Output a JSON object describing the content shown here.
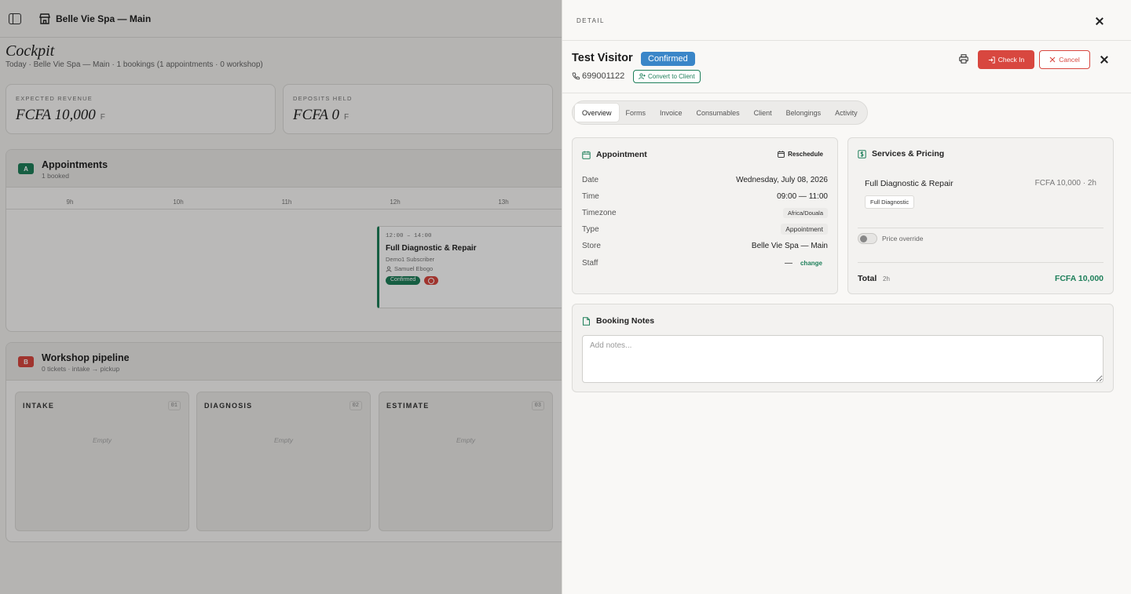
{
  "header": {
    "store_name": "Belle Vie Spa — Main"
  },
  "page": {
    "title": "Cockpit",
    "subtitle": "Today · Belle Vie Spa — Main · 1 bookings (1 appointments · 0 workshop)"
  },
  "kpis": [
    {
      "label": "EXPECTED REVENUE",
      "value": "FCFA 10,000",
      "unit": "F"
    },
    {
      "label": "DEPOSITS HELD",
      "value": "FCFA 0",
      "unit": "F"
    }
  ],
  "appointments": {
    "badge": "A",
    "title": "Appointments",
    "subtitle": "1 booked",
    "hours": [
      "9h",
      "10h",
      "11h",
      "12h",
      "13h"
    ],
    "card": {
      "time": "12:00 – 14:00",
      "service": "Full Diagnostic & Repair",
      "client": "Demo1 Subscriber",
      "staff": "Samuel Ebogo",
      "status": "Confirmed"
    }
  },
  "workshop": {
    "badge": "B",
    "title": "Workshop pipeline",
    "subtitle": "0 tickets · intake → pickup",
    "columns": [
      {
        "title": "INTAKE",
        "num": "01",
        "empty": "Empty"
      },
      {
        "title": "DIAGNOSIS",
        "num": "02",
        "empty": "Empty"
      },
      {
        "title": "ESTIMATE",
        "num": "03",
        "empty": "Empty"
      }
    ]
  },
  "drawer": {
    "label": "DETAIL",
    "visitor": "Test Visitor",
    "status": "Confirmed",
    "phone": "699001122",
    "convert_label": "Convert to Client",
    "checkin_label": "Check In",
    "cancel_label": "Cancel",
    "tabs": [
      "Overview",
      "Forms",
      "Invoice",
      "Consumables",
      "Client",
      "Belongings",
      "Activity"
    ],
    "appointment": {
      "title": "Appointment",
      "reschedule_label": "Reschedule",
      "date_k": "Date",
      "date_v": "Wednesday, July 08, 2026",
      "time_k": "Time",
      "time_v": "09:00 — 11:00",
      "tz_k": "Timezone",
      "tz_v": "Africa/Douala",
      "type_k": "Type",
      "type_v": "Appointment",
      "store_k": "Store",
      "store_v": "Belle Vie Spa — Main",
      "staff_k": "Staff",
      "staff_v": "—",
      "change_label": "change"
    },
    "services": {
      "title": "Services & Pricing",
      "name": "Full Diagnostic & Repair",
      "price": "FCFA 10,000 · 2h",
      "chip": "Full Diagnostic",
      "override_label": "Price override",
      "total_k": "Total",
      "total_dur": "2h",
      "total_v": "FCFA 10,000"
    },
    "notes": {
      "title": "Booking Notes",
      "placeholder": "Add notes..."
    }
  },
  "colors": {
    "accent_green": "#1e7f5a",
    "danger_red": "#d8473f",
    "confirmed_blue": "#3a86c8"
  }
}
